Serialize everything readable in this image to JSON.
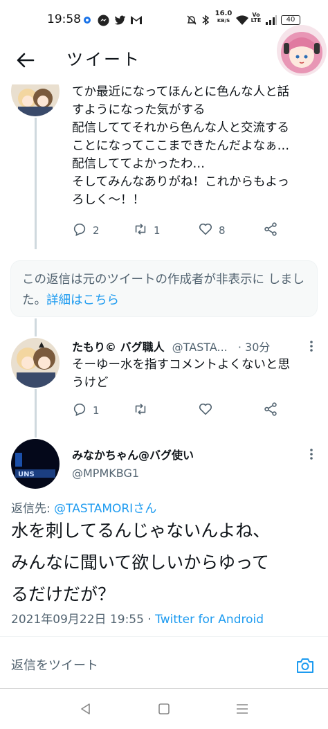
{
  "status_bar": {
    "time": "19:58",
    "network_speed": "16.0",
    "network_unit": "KB/S",
    "volte": "Vo LTE",
    "battery": "40",
    "left_icons": [
      "settings-icon",
      "messenger-icon",
      "twitter-icon",
      "gmail-icon"
    ],
    "right_icons": [
      "alarm-icon",
      "bluetooth-icon",
      "wifi-icon",
      "signal-icon"
    ]
  },
  "header": {
    "title": "ツイート",
    "back_icon": "arrow-left-icon"
  },
  "parent_tweet": {
    "text": "てか最近になってほんとに色んな人と話\nすようになった気がする\n配信しててそれから色んな人と交流する\nことになってここまできたんだよなぁ…\n配信しててよかったわ…\nそしてみんなありがね！これからもよっ\nろしく〜！！",
    "reply_count": "2",
    "retweet_count": "1",
    "like_count": "8"
  },
  "hidden_notice": {
    "text": "この返信は元のツイートの作成者が非表示に しました。",
    "link": "詳細はこちら"
  },
  "reply_tweet": {
    "name": "たもり© バグ職人",
    "handle": "@TASTA...",
    "time": "· 30分",
    "text": "そーゆー水を指すコメントよくないと思\nうけど",
    "reply_count": "1"
  },
  "main_tweet": {
    "name": "みなかちゃん@バグ使い",
    "handle": "@MPMKBG1",
    "reply_to_label": "返信先: ",
    "reply_to_handle": "@TASTAMORIさん",
    "text": "水を刺してるんじゃないんよね、\nみんなに聞いて欲しいからゆって\nるだけだが？",
    "timestamp": "2021年09月22日 19:55 · ",
    "source": "Twitter for Android"
  },
  "reply_bar": {
    "placeholder": "返信をツイート"
  },
  "colors": {
    "accent": "#1d9bf0",
    "secondary_text": "#536471",
    "thread_line": "#cfd9de"
  }
}
